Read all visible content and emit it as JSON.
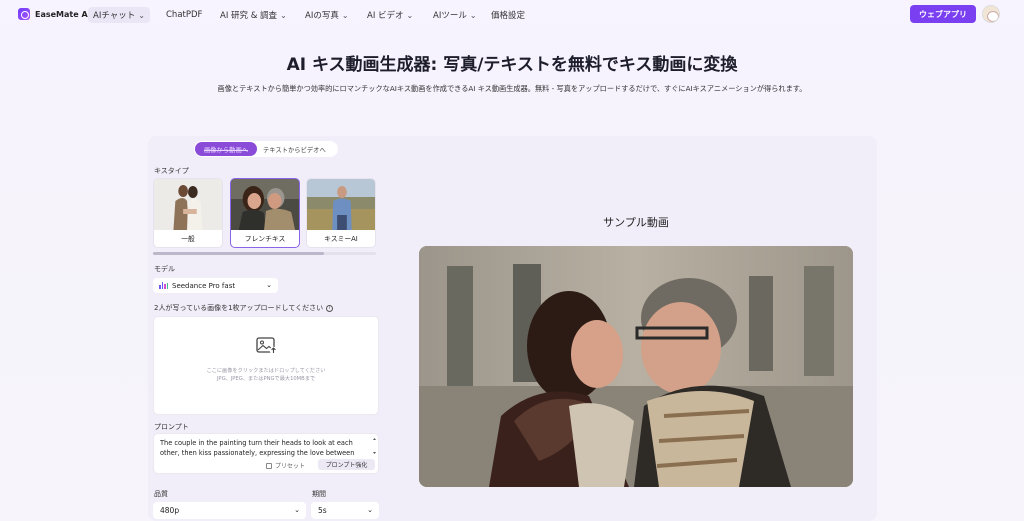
{
  "nav": {
    "brand": "EaseMate AI",
    "items": [
      {
        "label": "AIチャット",
        "has_menu": true,
        "active": true
      },
      {
        "label": "ChatPDF",
        "has_menu": false,
        "active": false
      },
      {
        "label": "AI 研究 & 調査",
        "has_menu": true,
        "active": false
      },
      {
        "label": "AIの写真",
        "has_menu": true,
        "active": false
      },
      {
        "label": "AI ビデオ",
        "has_menu": true,
        "active": false
      },
      {
        "label": "AIツール",
        "has_menu": true,
        "active": false
      },
      {
        "label": "価格設定",
        "has_menu": false,
        "active": false
      }
    ],
    "web_app_button": "ウェブアプリ"
  },
  "hero": {
    "title": "AI キス動画生成器: 写真/テキストを無料でキス動画に変換",
    "subtitle": "画像とテキストから簡単かつ効率的にロマンチックなAIキス動画を作成できるAI キス動画生成器。無料 - 写真をアップロードするだけで、すぐにAIキスアニメーションが得られます。"
  },
  "mode_tabs": [
    {
      "label": "画像から動画へ",
      "active": true
    },
    {
      "label": "テキストからビデオへ",
      "active": false
    }
  ],
  "kiss_type": {
    "label": "キスタイプ",
    "options": [
      {
        "label": "一般",
        "selected": false
      },
      {
        "label": "フレンチキス",
        "selected": true
      },
      {
        "label": "キスミーAI",
        "selected": false
      }
    ]
  },
  "model": {
    "label": "モデル",
    "value": "Seedance Pro fast"
  },
  "upload": {
    "label": "2人が写っている画像を1枚アップロードしてください",
    "hint_line1": "ここに画像をクリックまたはドロップしてください",
    "hint_line2": "JPG、JPEG、またはPNGで最大10MBまで"
  },
  "prompt": {
    "label": "プロンプト",
    "value": "The couple in the painting turn their heads to look at each other, then kiss passionately, expressing the love between",
    "preset_label": "プリセット",
    "enhance_label": "プロンプト強化"
  },
  "quality": {
    "label": "品質",
    "value": "480p"
  },
  "duration": {
    "label": "期間",
    "value": "5s"
  },
  "sample": {
    "title": "サンプル動画"
  },
  "colors": {
    "accent": "#7b3ff2",
    "tab_active": "#8b4bd9",
    "panel": "#f2eef9"
  }
}
